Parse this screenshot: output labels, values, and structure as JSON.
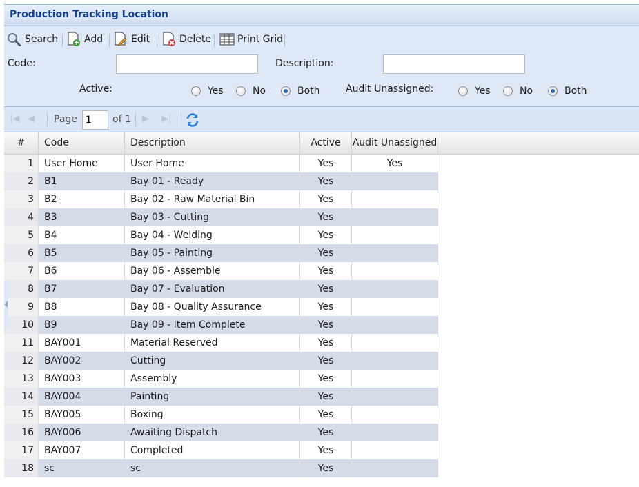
{
  "window": {
    "title": "Production Tracking Location"
  },
  "toolbar": {
    "search_label": "Search",
    "add_label": "Add",
    "edit_label": "Edit",
    "delete_label": "Delete",
    "print_label": "Print Grid"
  },
  "filters": {
    "code_label": "Code:",
    "code_value": "",
    "description_label": "Description:",
    "description_value": "",
    "active_label": "Active:",
    "active_options": [
      "Yes",
      "No",
      "Both"
    ],
    "active_selected": "Both",
    "audit_label": "Audit Unassigned:",
    "audit_options": [
      "Yes",
      "No",
      "Both"
    ],
    "audit_selected": "Both"
  },
  "pager": {
    "page_label": "Page",
    "page_value": "1",
    "of_label": "of 1"
  },
  "grid": {
    "columns": [
      "#",
      "Code",
      "Description",
      "Active",
      "Audit Unassigned"
    ],
    "rows": [
      {
        "num": "1",
        "code": "User Home",
        "description": "User Home",
        "active": "Yes",
        "audit": "Yes"
      },
      {
        "num": "2",
        "code": "B1",
        "description": "Bay 01 - Ready",
        "active": "Yes",
        "audit": ""
      },
      {
        "num": "3",
        "code": "B2",
        "description": "Bay 02 - Raw Material Bin",
        "active": "Yes",
        "audit": ""
      },
      {
        "num": "4",
        "code": "B3",
        "description": "Bay 03 - Cutting",
        "active": "Yes",
        "audit": ""
      },
      {
        "num": "5",
        "code": "B4",
        "description": "Bay 04 - Welding",
        "active": "Yes",
        "audit": ""
      },
      {
        "num": "6",
        "code": "B5",
        "description": "Bay 05 - Painting",
        "active": "Yes",
        "audit": ""
      },
      {
        "num": "7",
        "code": "B6",
        "description": "Bay 06 - Assemble",
        "active": "Yes",
        "audit": ""
      },
      {
        "num": "8",
        "code": "B7",
        "description": "Bay 07 - Evaluation",
        "active": "Yes",
        "audit": ""
      },
      {
        "num": "9",
        "code": "B8",
        "description": "Bay 08 - Quality Assurance",
        "active": "Yes",
        "audit": ""
      },
      {
        "num": "10",
        "code": "B9",
        "description": "Bay 09 - Item Complete",
        "active": "Yes",
        "audit": ""
      },
      {
        "num": "11",
        "code": "BAY001",
        "description": "Material Reserved",
        "active": "Yes",
        "audit": ""
      },
      {
        "num": "12",
        "code": "BAY002",
        "description": "Cutting",
        "active": "Yes",
        "audit": ""
      },
      {
        "num": "13",
        "code": "BAY003",
        "description": "Assembly",
        "active": "Yes",
        "audit": ""
      },
      {
        "num": "14",
        "code": "BAY004",
        "description": "Painting",
        "active": "Yes",
        "audit": ""
      },
      {
        "num": "15",
        "code": "BAY005",
        "description": "Boxing",
        "active": "Yes",
        "audit": ""
      },
      {
        "num": "16",
        "code": "BAY006",
        "description": "Awaiting Dispatch",
        "active": "Yes",
        "audit": ""
      },
      {
        "num": "17",
        "code": "BAY007",
        "description": "Completed",
        "active": "Yes",
        "audit": ""
      },
      {
        "num": "18",
        "code": "sc",
        "description": "sc",
        "active": "Yes",
        "audit": ""
      }
    ]
  }
}
